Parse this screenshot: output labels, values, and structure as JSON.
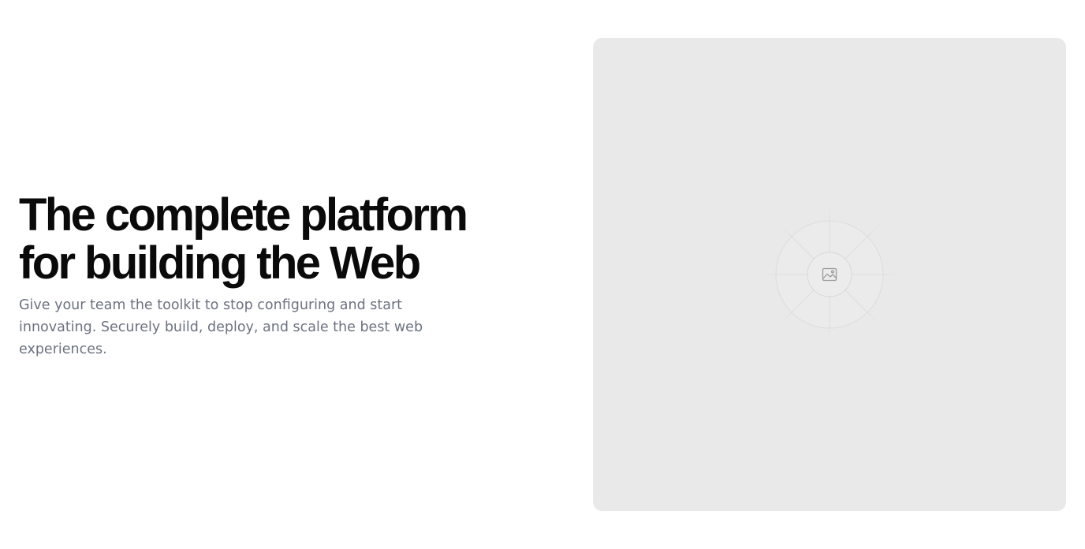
{
  "hero": {
    "headline_line1": "The complete platform",
    "headline_line2": "for building the Web",
    "subtitle": "Give your team the toolkit to stop configuring and start innovating. Securely build, deploy, and scale the best web experiences."
  },
  "media": {
    "icon": "image-placeholder-icon",
    "background_color": "#e9e9e9"
  }
}
